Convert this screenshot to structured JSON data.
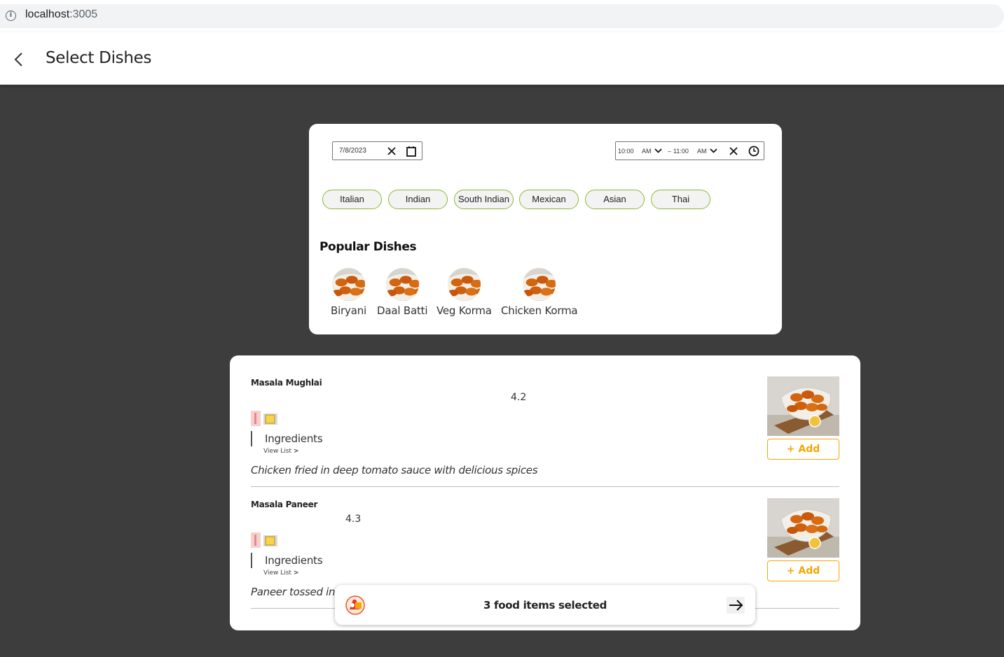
{
  "browser": {
    "host": "localhost",
    "port": ":3005"
  },
  "header": {
    "title": "Select Dishes"
  },
  "filters": {
    "date": "7/8/2023",
    "time_start": "10:00",
    "time_start_period": "AM",
    "time_separator": "–",
    "time_end": "11:00",
    "time_end_period": "AM"
  },
  "cuisines": [
    "Italian",
    "Indian",
    "South Indian",
    "Mexican",
    "Asian",
    "Thai"
  ],
  "popular": {
    "title": "Popular Dishes",
    "items": [
      "Biryani",
      "Daal Batti",
      "Veg Korma",
      "Chicken Korma"
    ]
  },
  "dishes": [
    {
      "name": "Masala Mughlai",
      "rating": "4.2",
      "ingredients_label": "Ingredients",
      "view_list": "View List",
      "description": "Chicken fried in deep tomato sauce with delicious spices",
      "add_label": "+ Add"
    },
    {
      "name": "Masala Paneer",
      "rating": "4.3",
      "ingredients_label": "Ingredients",
      "view_list": "View List",
      "description": "Paneer tossed in",
      "add_label": "+ Add"
    }
  ],
  "selection": {
    "text": "3 food items selected"
  },
  "colors": {
    "accent": "#f5a700",
    "chip_border": "#8bbb32",
    "backdrop": "#3d3d3d"
  }
}
